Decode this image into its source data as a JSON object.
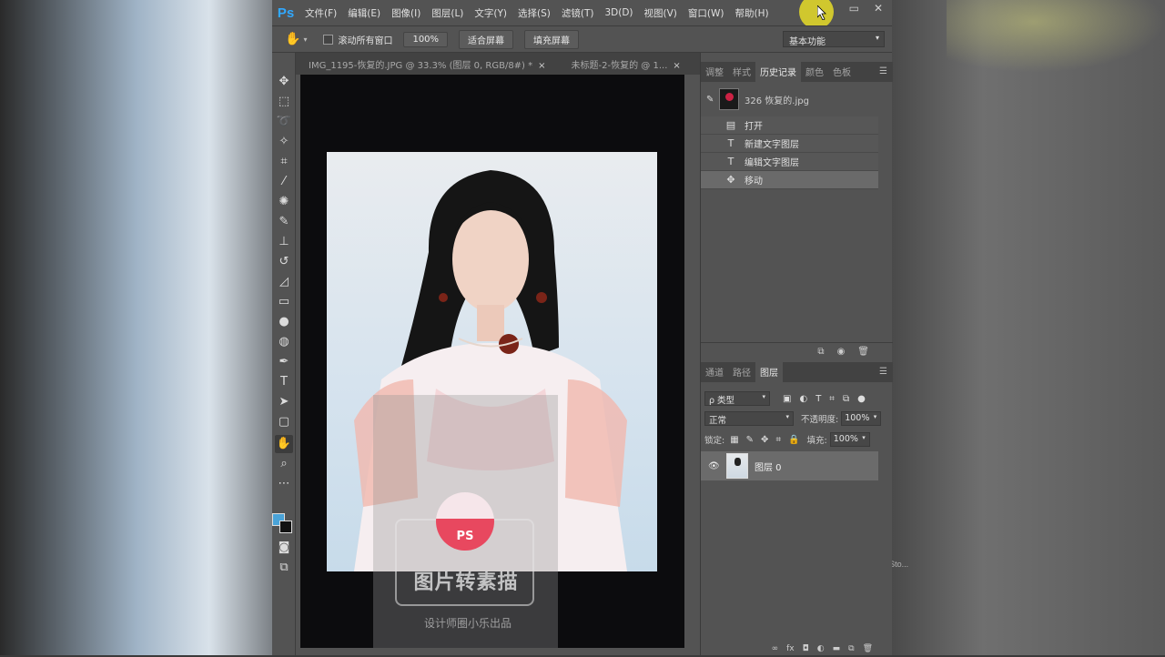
{
  "app": {
    "logo": "Ps"
  },
  "menu": [
    "文件(F)",
    "编辑(E)",
    "图像(I)",
    "图层(L)",
    "文字(Y)",
    "选择(S)",
    "滤镜(T)",
    "3D(D)",
    "视图(V)",
    "窗口(W)",
    "帮助(H)"
  ],
  "window_controls": {
    "minimize": "▭",
    "close": "✕"
  },
  "options_bar": {
    "tool_icon": "hand-icon",
    "scroll_all_windows": "滚动所有窗口",
    "zoom_100": "100%",
    "fit_screen": "适合屏幕",
    "fill_screen": "填充屏幕",
    "workspace": "基本功能"
  },
  "document_tabs": [
    {
      "label": "IMG_1195-恢复的.JPG @ 33.3% (图层 0, RGB/8#) *"
    },
    {
      "label": "未标题-2-恢复的 @ 1..."
    }
  ],
  "canvas": {
    "watermark_title": "图片转素描",
    "watermark_sub": "设计师圈小乐出品",
    "watermark_logo": "PS",
    "signature": "@CarmeSto..."
  },
  "history_panel": {
    "tabs": [
      "调整",
      "样式",
      "历史记录",
      "颜色",
      "色板"
    ],
    "active_tab": "历史记录",
    "snapshot": "326 恢复的.jpg",
    "steps": [
      {
        "icon": "document-icon",
        "glyph": "▤",
        "label": "打开"
      },
      {
        "icon": "type-icon",
        "glyph": "T",
        "label": "新建文字图层"
      },
      {
        "icon": "type-icon",
        "glyph": "T",
        "label": "编辑文字图层"
      },
      {
        "icon": "move-icon",
        "glyph": "✥",
        "label": "移动"
      }
    ],
    "active_step": "移动"
  },
  "layers_panel": {
    "tabs": [
      "通道",
      "路径",
      "图层"
    ],
    "active_tab": "图层",
    "kind_filter": "ρ 类型",
    "blend_mode": "正常",
    "opacity_label": "不透明度:",
    "opacity": "100%",
    "lock_label": "锁定:",
    "fill_label": "填充:",
    "fill": "100%",
    "layers": [
      {
        "name": "图层 0",
        "visible": true
      }
    ]
  },
  "colors": {
    "foreground": "#4aa3d8",
    "background": "#111111",
    "accent": "#31a8ff"
  }
}
